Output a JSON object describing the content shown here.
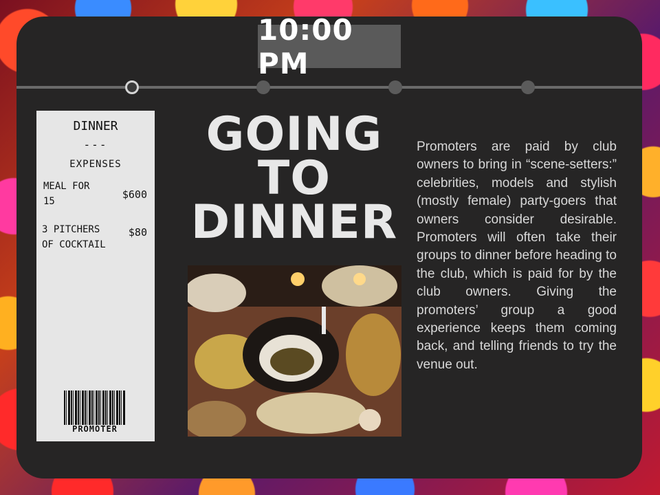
{
  "header": {
    "time": "10:00 PM"
  },
  "timeline": {
    "stops": 4,
    "active_index": 0
  },
  "receipt": {
    "title": "DINNER",
    "separator": "---",
    "subtitle": "EXPENSES",
    "items": [
      {
        "label_line1": "MEAL FOR",
        "label_line2": "15",
        "price": "$600"
      },
      {
        "label_line1": "3 PITCHERS",
        "label_line2": "OF COCKTAIL",
        "price": "$80"
      }
    ],
    "barcode_label": "PROMOTER"
  },
  "main": {
    "headline": [
      "GOING",
      "TO",
      "DINNER"
    ],
    "body": "Promoters are paid by club owners to bring in “scene-setters:” celebrities, models and stylish (mostly female) party-goers that owners consider desirable. Promoters will often take their groups to dinner before heading to the club, which is paid for by the club owners. Giving the promoters’ group a good experience keeps them coming back, and telling friends to try the venue out."
  },
  "colors": {
    "panel": "#262525",
    "time_box": "#5a5a5a",
    "receipt": "#e6e6e6",
    "headline": "#e8e8e8",
    "timeline": "#6a6a6a"
  }
}
